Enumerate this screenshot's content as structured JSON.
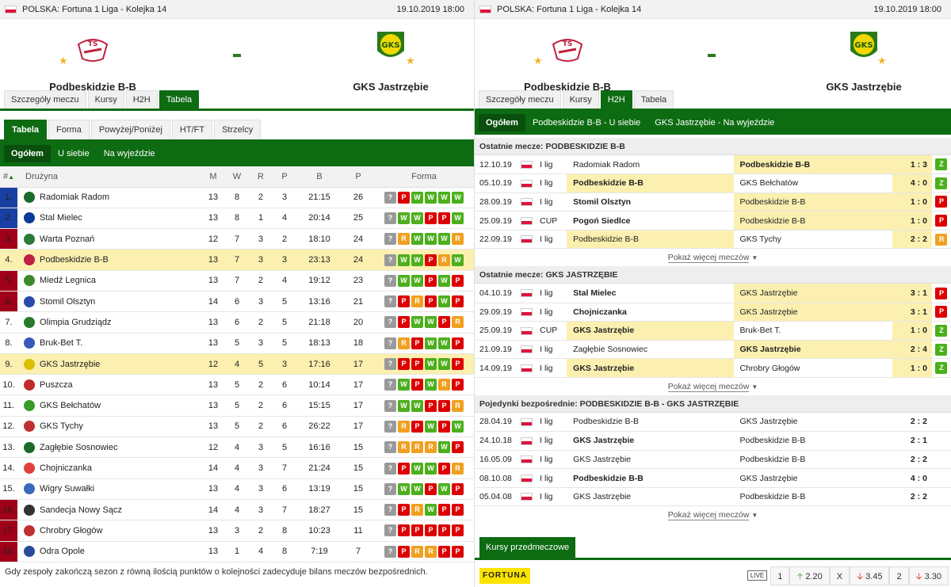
{
  "match": {
    "competition": "POLSKA: Fortuna 1 Liga - Kolejka 14",
    "date": "19.10.2019 18:00",
    "home": "Podbeskidzie B-B",
    "away": "GKS Jastrzębie",
    "separator": "-"
  },
  "main_tabs": [
    "Szczegóły meczu",
    "Kursy",
    "H2H",
    "Tabela"
  ],
  "left": {
    "sub_tabs": [
      "Tabela",
      "Forma",
      "Powyżej/Poniżej",
      "HT/FT",
      "Strzelcy"
    ],
    "filters": [
      "Ogółem",
      "U siebie",
      "Na wyjeździe"
    ],
    "columns": [
      "#",
      "Drużyna",
      "M",
      "W",
      "R",
      "P",
      "B",
      "P",
      "Forma"
    ],
    "rows": [
      {
        "pos": "1.",
        "team": "Radomiak Radom",
        "m": "13",
        "w": "8",
        "r": "2",
        "p": "3",
        "b": "21:15",
        "pts": "26",
        "form": [
          "?",
          "P",
          "W",
          "W",
          "W",
          "W"
        ],
        "zone": "b",
        "logo": "#1a6a2a"
      },
      {
        "pos": "2.",
        "team": "Stal Mielec",
        "m": "13",
        "w": "8",
        "r": "1",
        "p": "4",
        "b": "20:14",
        "pts": "25",
        "form": [
          "?",
          "W",
          "W",
          "P",
          "P",
          "W"
        ],
        "zone": "b",
        "logo": "#0a3a9a"
      },
      {
        "pos": "3.",
        "team": "Warta Poznań",
        "m": "12",
        "w": "7",
        "r": "3",
        "p": "2",
        "b": "18:10",
        "pts": "24",
        "form": [
          "?",
          "R",
          "W",
          "W",
          "W",
          "R"
        ],
        "zone": "r",
        "logo": "#2a7a3a"
      },
      {
        "pos": "4.",
        "team": "Podbeskidzie B-B",
        "m": "13",
        "w": "7",
        "r": "3",
        "p": "3",
        "b": "23:13",
        "pts": "24",
        "form": [
          "?",
          "W",
          "W",
          "P",
          "R",
          "W"
        ],
        "zone": "r",
        "logo": "#c02040",
        "hl": true
      },
      {
        "pos": "5.",
        "team": "Miedź Legnica",
        "m": "13",
        "w": "7",
        "r": "2",
        "p": "4",
        "b": "19:12",
        "pts": "23",
        "form": [
          "?",
          "W",
          "W",
          "P",
          "W",
          "P"
        ],
        "zone": "r",
        "logo": "#3a8a2a"
      },
      {
        "pos": "6.",
        "team": "Stomil Olsztyn",
        "m": "14",
        "w": "6",
        "r": "3",
        "p": "5",
        "b": "13:16",
        "pts": "21",
        "form": [
          "?",
          "P",
          "R",
          "P",
          "W",
          "P"
        ],
        "zone": "r",
        "logo": "#2a4aaa"
      },
      {
        "pos": "7.",
        "team": "Olimpia Grudziądz",
        "m": "13",
        "w": "6",
        "r": "2",
        "p": "5",
        "b": "21:18",
        "pts": "20",
        "form": [
          "?",
          "P",
          "W",
          "W",
          "P",
          "R"
        ],
        "zone": "n",
        "logo": "#2a7a2a"
      },
      {
        "pos": "8.",
        "team": "Bruk-Bet T.",
        "m": "13",
        "w": "5",
        "r": "3",
        "p": "5",
        "b": "18:13",
        "pts": "18",
        "form": [
          "?",
          "R",
          "P",
          "W",
          "W",
          "P"
        ],
        "zone": "n",
        "logo": "#3a5aba"
      },
      {
        "pos": "9.",
        "team": "GKS Jastrzębie",
        "m": "12",
        "w": "4",
        "r": "5",
        "p": "3",
        "b": "17:16",
        "pts": "17",
        "form": [
          "?",
          "P",
          "P",
          "W",
          "W",
          "P"
        ],
        "zone": "n",
        "logo": "#d8c000",
        "hl": true
      },
      {
        "pos": "10.",
        "team": "Puszcza",
        "m": "13",
        "w": "5",
        "r": "2",
        "p": "6",
        "b": "10:14",
        "pts": "17",
        "form": [
          "?",
          "W",
          "P",
          "W",
          "R",
          "P"
        ],
        "zone": "n",
        "logo": "#c02a2a"
      },
      {
        "pos": "11.",
        "team": "GKS Bełchatów",
        "m": "13",
        "w": "5",
        "r": "2",
        "p": "6",
        "b": "15:15",
        "pts": "17",
        "form": [
          "?",
          "W",
          "W",
          "P",
          "P",
          "R"
        ],
        "zone": "n",
        "logo": "#3a9a2a"
      },
      {
        "pos": "12.",
        "team": "GKS Tychy",
        "m": "13",
        "w": "5",
        "r": "2",
        "p": "6",
        "b": "26:22",
        "pts": "17",
        "form": [
          "?",
          "R",
          "P",
          "W",
          "P",
          "W"
        ],
        "zone": "n",
        "logo": "#c03030"
      },
      {
        "pos": "13.",
        "team": "Zagłębie Sosnowiec",
        "m": "12",
        "w": "4",
        "r": "3",
        "p": "5",
        "b": "16:16",
        "pts": "15",
        "form": [
          "?",
          "R",
          "R",
          "R",
          "W",
          "P"
        ],
        "zone": "n",
        "logo": "#1a6a2a"
      },
      {
        "pos": "14.",
        "team": "Chojniczanka",
        "m": "14",
        "w": "4",
        "r": "3",
        "p": "7",
        "b": "21:24",
        "pts": "15",
        "form": [
          "?",
          "P",
          "W",
          "W",
          "P",
          "R"
        ],
        "zone": "n",
        "logo": "#e04040"
      },
      {
        "pos": "15.",
        "team": "Wigry Suwałki",
        "m": "13",
        "w": "4",
        "r": "3",
        "p": "6",
        "b": "13:19",
        "pts": "15",
        "form": [
          "?",
          "W",
          "W",
          "P",
          "W",
          "P"
        ],
        "zone": "n",
        "logo": "#3a6aba"
      },
      {
        "pos": "16.",
        "team": "Sandecja Nowy Sącz",
        "m": "14",
        "w": "4",
        "r": "3",
        "p": "7",
        "b": "18:27",
        "pts": "15",
        "form": [
          "?",
          "P",
          "R",
          "W",
          "P",
          "P"
        ],
        "zone": "r",
        "logo": "#333333"
      },
      {
        "pos": "17.",
        "team": "Chrobry Głogów",
        "m": "13",
        "w": "3",
        "r": "2",
        "p": "8",
        "b": "10:23",
        "pts": "11",
        "form": [
          "?",
          "P",
          "P",
          "P",
          "P",
          "P"
        ],
        "zone": "r",
        "logo": "#c03030"
      },
      {
        "pos": "18.",
        "team": "Odra Opole",
        "m": "13",
        "w": "1",
        "r": "4",
        "p": "8",
        "b": "7:19",
        "pts": "7",
        "form": [
          "?",
          "P",
          "R",
          "R",
          "P",
          "P"
        ],
        "zone": "r",
        "logo": "#2a4a9a"
      }
    ],
    "footnote": "Gdy zespoły zakończą sezon z równą ilością punktów o kolejności zadecyduje bilans meczów bezpośrednich."
  },
  "right": {
    "h2h_tabs": [
      "Ogółem",
      "Podbeskidzie B-B - U siebie",
      "GKS Jastrzębie - Na wyjeździe"
    ],
    "more_label": "Pokaż więcej meczów",
    "sections": [
      {
        "title": "Ostatnie mecze: PODBESKIDZIE B-B",
        "rows": [
          {
            "date": "12.10.19",
            "league": "I lig",
            "home": "Radomiak Radom",
            "away": "Podbeskidzie B-B",
            "score": "1 : 3",
            "res": "Z",
            "bold": "away",
            "hl": "away"
          },
          {
            "date": "05.10.19",
            "league": "I lig",
            "home": "Podbeskidzie B-B",
            "away": "GKS Bełchatów",
            "score": "4 : 0",
            "res": "Z",
            "bold": "home",
            "hl": "home"
          },
          {
            "date": "28.09.19",
            "league": "I lig",
            "home": "Stomil Olsztyn",
            "away": "Podbeskidzie B-B",
            "score": "1 : 0",
            "res": "P",
            "bold": "home",
            "hl": "away"
          },
          {
            "date": "25.09.19",
            "league": "CUP",
            "home": "Pogoń Siedlce",
            "away": "Podbeskidzie B-B",
            "score": "1 : 0",
            "res": "P",
            "bold": "home",
            "hl": "away"
          },
          {
            "date": "22.09.19",
            "league": "I lig",
            "home": "Podbeskidzie B-B",
            "away": "GKS Tychy",
            "score": "2 : 2",
            "res": "R",
            "bold": "",
            "hl": "home"
          }
        ]
      },
      {
        "title": "Ostatnie mecze: GKS JASTRZĘBIE",
        "rows": [
          {
            "date": "04.10.19",
            "league": "I lig",
            "home": "Stal Mielec",
            "away": "GKS Jastrzębie",
            "score": "3 : 1",
            "res": "P",
            "bold": "home",
            "hl": "away"
          },
          {
            "date": "29.09.19",
            "league": "I lig",
            "home": "Chojniczanka",
            "away": "GKS Jastrzębie",
            "score": "3 : 1",
            "res": "P",
            "bold": "home",
            "hl": "away"
          },
          {
            "date": "25.09.19",
            "league": "CUP",
            "home": "GKS Jastrzębie",
            "away": "Bruk-Bet T.",
            "score": "1 : 0",
            "res": "Z",
            "bold": "home",
            "hl": "home"
          },
          {
            "date": "21.09.19",
            "league": "I lig",
            "home": "Zagłębie Sosnowiec",
            "away": "GKS Jastrzębie",
            "score": "2 : 4",
            "res": "Z",
            "bold": "away",
            "hl": "away"
          },
          {
            "date": "14.09.19",
            "league": "I lig",
            "home": "GKS Jastrzębie",
            "away": "Chrobry Głogów",
            "score": "1 : 0",
            "res": "Z",
            "bold": "home",
            "hl": "home"
          }
        ]
      },
      {
        "title": "Pojedynki bezpośrednie: PODBESKIDZIE B-B - GKS JASTRZĘBIE",
        "rows": [
          {
            "date": "28.04.19",
            "league": "I lig",
            "home": "Podbeskidzie B-B",
            "away": "GKS Jastrzębie",
            "score": "2 : 2",
            "res": "",
            "bold": "",
            "hl": ""
          },
          {
            "date": "24.10.18",
            "league": "I lig",
            "home": "GKS Jastrzębie",
            "away": "Podbeskidzie B-B",
            "score": "2 : 1",
            "res": "",
            "bold": "home",
            "hl": ""
          },
          {
            "date": "16.05.09",
            "league": "I lig",
            "home": "GKS Jastrzębie",
            "away": "Podbeskidzie B-B",
            "score": "2 : 2",
            "res": "",
            "bold": "",
            "hl": ""
          },
          {
            "date": "08.10.08",
            "league": "I lig",
            "home": "Podbeskidzie B-B",
            "away": "GKS Jastrzębie",
            "score": "4 : 0",
            "res": "",
            "bold": "home",
            "hl": ""
          },
          {
            "date": "05.04.08",
            "league": "I lig",
            "home": "GKS Jastrzębie",
            "away": "Podbeskidzie B-B",
            "score": "2 : 2",
            "res": "",
            "bold": "",
            "hl": ""
          }
        ]
      }
    ],
    "odds": {
      "tab": "Kursy przedmeczowe",
      "bookmaker": "FORTUNA",
      "live": "LIVE",
      "items": [
        {
          "label": "1",
          "value": "2.20",
          "dir": "up"
        },
        {
          "label": "X",
          "value": "3.45",
          "dir": "dn"
        },
        {
          "label": "2",
          "value": "3.30",
          "dir": "dn"
        }
      ]
    }
  }
}
